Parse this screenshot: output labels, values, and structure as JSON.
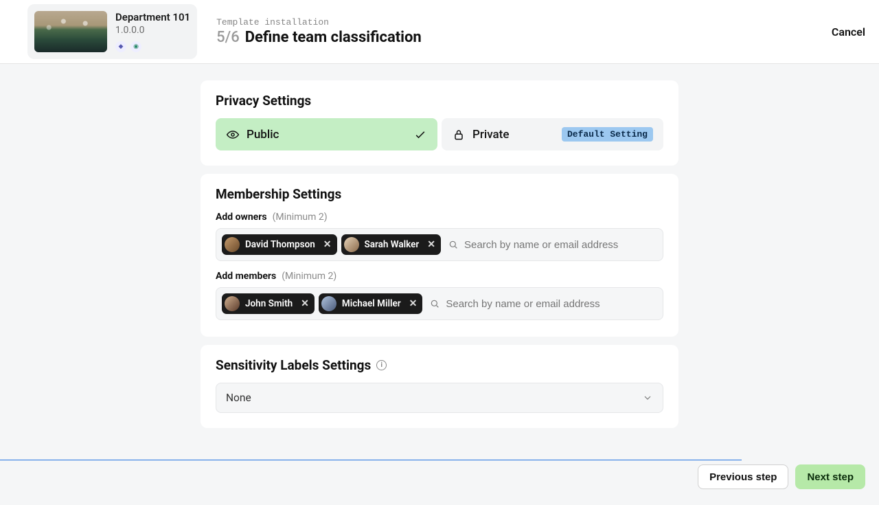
{
  "header": {
    "template_name": "Department 101",
    "template_version": "1.0.0.0",
    "wizard_label": "Template installation",
    "step_counter": "5/6",
    "step_name": "Define team classification",
    "cancel": "Cancel"
  },
  "privacy": {
    "section_title": "Privacy Settings",
    "public_label": "Public",
    "private_label": "Private",
    "default_badge": "Default Setting",
    "selected": "public"
  },
  "membership": {
    "section_title": "Membership Settings",
    "owners_label": "Add owners",
    "owners_hint": "(Minimum 2)",
    "owners": [
      {
        "name": "David Thompson"
      },
      {
        "name": "Sarah Walker"
      }
    ],
    "members_label": "Add members",
    "members_hint": "(Minimum 2)",
    "members": [
      {
        "name": "John Smith"
      },
      {
        "name": "Michael Miller"
      }
    ],
    "search_placeholder": "Search by name or email address"
  },
  "sensitivity": {
    "section_title": "Sensitivity Labels Settings",
    "selected_value": "None"
  },
  "footer": {
    "prev": "Previous step",
    "next": "Next step"
  },
  "avatar_gradients": [
    "linear-gradient(135deg,#c49a6c,#6b4a2a)",
    "linear-gradient(135deg,#e6d2b8,#8a6a4a)",
    "linear-gradient(135deg,#d0b090,#5a3a2a)",
    "linear-gradient(135deg,#b0c4de,#4a5a7a)"
  ]
}
